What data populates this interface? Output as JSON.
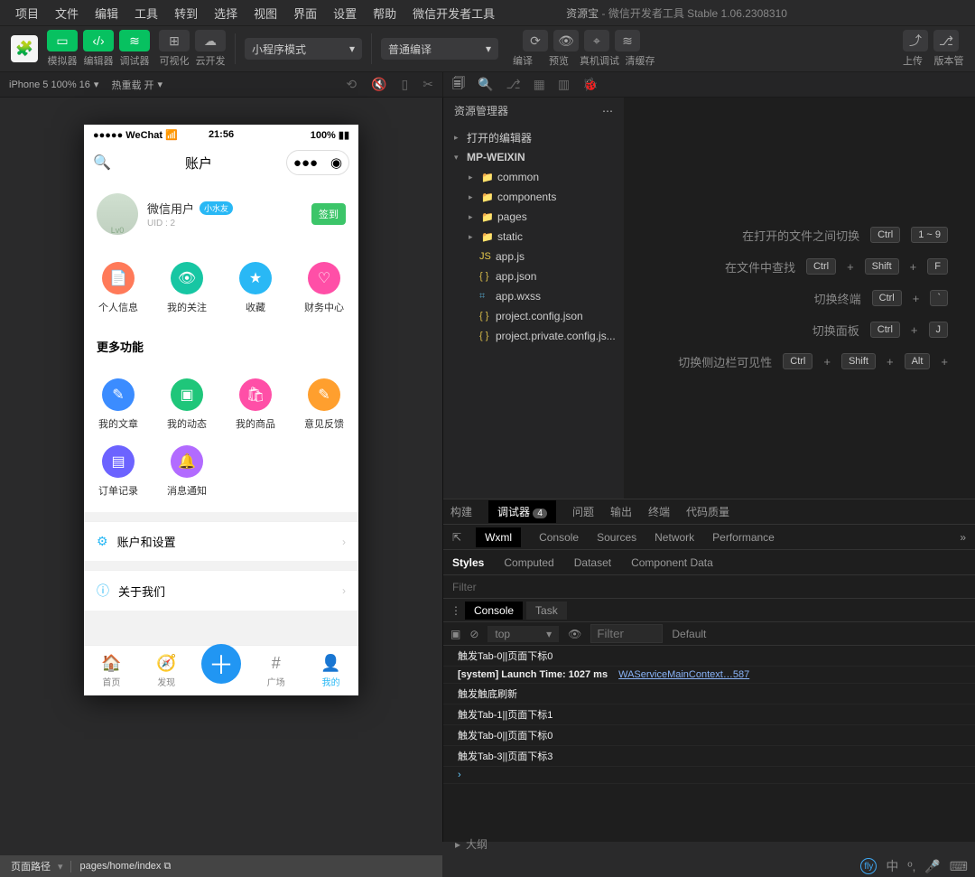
{
  "menubar": [
    "项目",
    "文件",
    "编辑",
    "工具",
    "转到",
    "选择",
    "视图",
    "界面",
    "设置",
    "帮助",
    "微信开发者工具"
  ],
  "title": {
    "app": "资源宝",
    "suffix": " - 微信开发者工具 Stable 1.06.2308310"
  },
  "toolbar": {
    "sim": "模拟器",
    "editor": "编辑器",
    "debug": "调试器",
    "visual": "可视化",
    "cloud": "云开发",
    "mode": "小程序模式",
    "compile_mode": "普通编译",
    "compile": "编译",
    "preview": "预览",
    "real": "真机调试",
    "cache": "清缓存",
    "upload": "上传",
    "version": "版本管"
  },
  "subbar": {
    "device": "iPhone 5 100% 16",
    "hot": "热重载 开"
  },
  "phone": {
    "carrier": "●●●●● WeChat",
    "wifi": "",
    "time": "21:56",
    "battery": "100%",
    "title": "账户",
    "user": {
      "name": "微信用户",
      "badge": "小水友",
      "uid": "UID : 2",
      "signin": "签到",
      "avatarText": "Lv0"
    },
    "grid1": [
      {
        "label": "个人信息",
        "color": "#ff7a59",
        "icon": "📄"
      },
      {
        "label": "我的关注",
        "color": "#17c6a3",
        "icon": "👁"
      },
      {
        "label": "收藏",
        "color": "#29b8f5",
        "icon": "★"
      },
      {
        "label": "财务中心",
        "color": "#ff4fa7",
        "icon": "♡"
      }
    ],
    "moreTitle": "更多功能",
    "grid2": [
      {
        "label": "我的文章",
        "color": "#3b8cff",
        "icon": "✎"
      },
      {
        "label": "我的动态",
        "color": "#1fc67a",
        "icon": "▣"
      },
      {
        "label": "我的商品",
        "color": "#ff4fa7",
        "icon": "🛍"
      },
      {
        "label": "意见反馈",
        "color": "#ff9f2e",
        "icon": "✎"
      },
      {
        "label": "订单记录",
        "color": "#6c63ff",
        "icon": "▤"
      },
      {
        "label": "消息通知",
        "color": "#b26bff",
        "icon": "🔔"
      }
    ],
    "list": [
      {
        "icon": "⚙",
        "text": "账户和设置"
      },
      {
        "icon": "ⓘ",
        "text": "关于我们"
      }
    ],
    "tabs": [
      {
        "icon": "🏠",
        "label": "首页"
      },
      {
        "icon": "🧭",
        "label": "发现"
      },
      {
        "icon": "＋",
        "label": "",
        "fab": true
      },
      {
        "icon": "#",
        "label": "广场"
      },
      {
        "icon": "👤",
        "label": "我的",
        "active": true
      }
    ]
  },
  "explorer": {
    "title": "资源管理器",
    "open": "打开的编辑器",
    "project": "MP-WEIXIN",
    "folders": [
      "common",
      "components",
      "pages",
      "static"
    ],
    "files": [
      {
        "name": "app.js",
        "cls": "file-js",
        "ico": "JS"
      },
      {
        "name": "app.json",
        "cls": "file-json",
        "ico": "{ }"
      },
      {
        "name": "app.wxss",
        "cls": "file-wxss",
        "ico": "⌗"
      },
      {
        "name": "project.config.json",
        "cls": "file-json",
        "ico": "{ }"
      },
      {
        "name": "project.private.config.js...",
        "cls": "file-json",
        "ico": "{ }"
      }
    ]
  },
  "shortcuts": [
    {
      "label": "在打开的文件之间切换",
      "keys": [
        "Ctrl",
        "1 ~ 9"
      ]
    },
    {
      "label": "在文件中查找",
      "keys": [
        "Ctrl",
        "+",
        "Shift",
        "+",
        "F"
      ]
    },
    {
      "label": "切换终端",
      "keys": [
        "Ctrl",
        "+",
        "`"
      ]
    },
    {
      "label": "切换面板",
      "keys": [
        "Ctrl",
        "+",
        "J"
      ]
    },
    {
      "label": "切换侧边栏可见性",
      "keys": [
        "Ctrl",
        "+",
        "Shift",
        "+",
        "Alt",
        "+"
      ]
    }
  ],
  "devtools": {
    "tabs1": [
      "构建",
      "调试器",
      "问题",
      "输出",
      "终端",
      "代码质量"
    ],
    "tabs1_active": "调试器",
    "tabs1_badge": "4",
    "tabs2": [
      "Wxml",
      "Console",
      "Sources",
      "Network",
      "Performance"
    ],
    "tabs2_active": "Wxml",
    "styletabs": [
      "Styles",
      "Computed",
      "Dataset",
      "Component Data"
    ],
    "styletabs_active": "Styles",
    "filter": "Filter",
    "console_tabs": [
      "Console",
      "Task"
    ],
    "console_active": "Console",
    "top": "top",
    "default": "Default",
    "filter_ph": "Filter",
    "logs": [
      "触发Tab-0||页面下标0",
      "[system] Launch Time: 1027 ms",
      "触发触底刷新",
      "触发Tab-1||页面下标1",
      "触发Tab-0||页面下标0",
      "触发Tab-3||页面下标3"
    ],
    "log_link": "WAServiceMainContext…587"
  },
  "footer": {
    "label": "页面路径",
    "path": "pages/home/index",
    "outline": "大纲"
  }
}
